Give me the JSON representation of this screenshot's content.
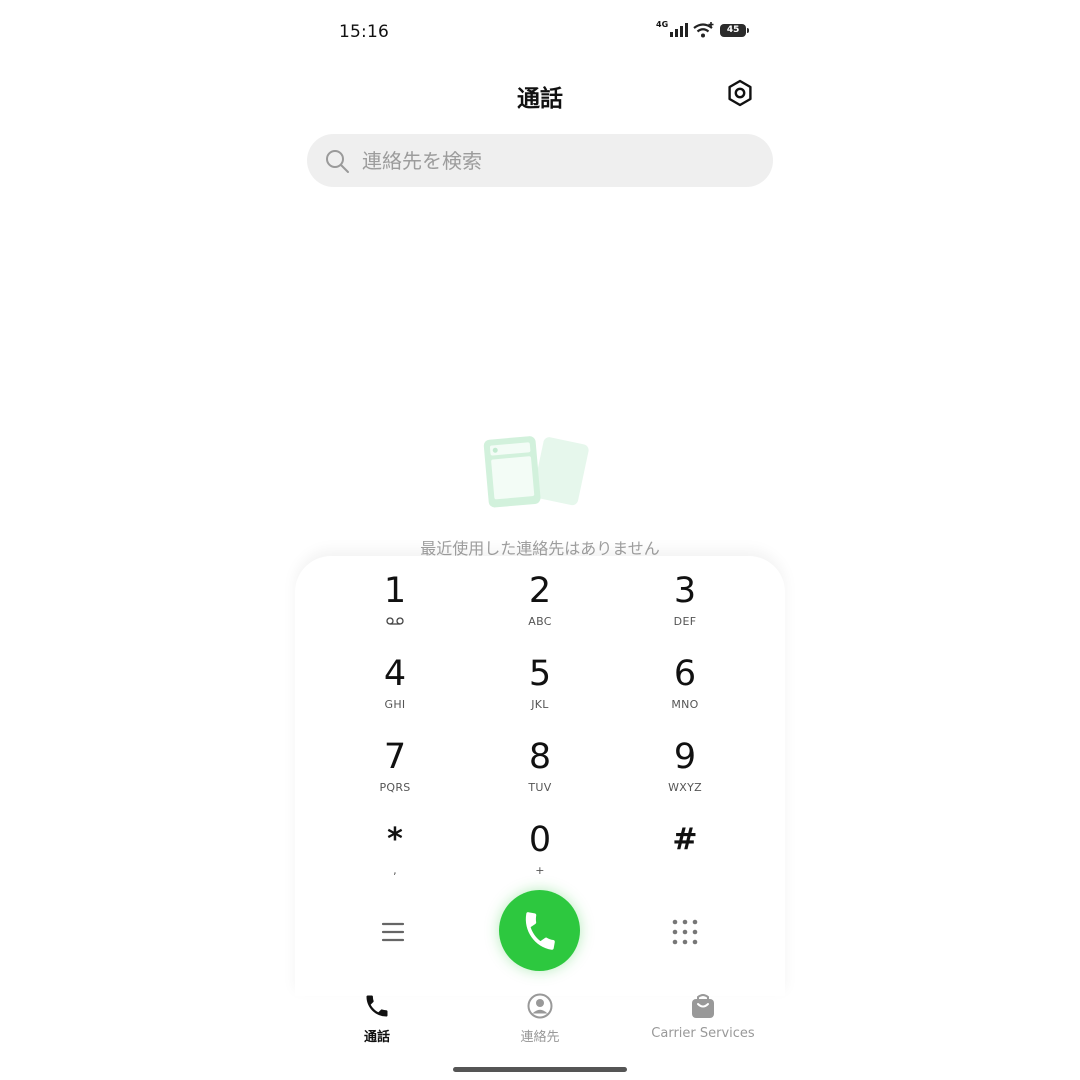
{
  "status_bar": {
    "time": "15:16",
    "network": "4G",
    "battery": "45",
    "icons": [
      "signal-icon",
      "wifi-icon",
      "battery-icon"
    ]
  },
  "header": {
    "title": "通話",
    "settings_icon": "settings-icon"
  },
  "search": {
    "placeholder": "連絡先を検索"
  },
  "empty_state": {
    "message": "最近使用した連絡先はありません"
  },
  "dialpad": {
    "keys": [
      {
        "digit": "1",
        "letters": "ꝏ"
      },
      {
        "digit": "2",
        "letters": "ABC"
      },
      {
        "digit": "3",
        "letters": "DEF"
      },
      {
        "digit": "4",
        "letters": "GHI"
      },
      {
        "digit": "5",
        "letters": "JKL"
      },
      {
        "digit": "6",
        "letters": "MNO"
      },
      {
        "digit": "7",
        "letters": "PQRS"
      },
      {
        "digit": "8",
        "letters": "TUV"
      },
      {
        "digit": "9",
        "letters": "WXYZ"
      },
      {
        "digit": "*",
        "letters": ","
      },
      {
        "digit": "0",
        "letters": "+"
      },
      {
        "digit": "#",
        "letters": ""
      }
    ],
    "call_button_color": "#2dc83f"
  },
  "bottom_nav": {
    "items": [
      {
        "label": "通話",
        "icon": "phone-icon",
        "active": true
      },
      {
        "label": "連絡先",
        "icon": "contact-icon",
        "active": false
      },
      {
        "label": "Carrier Services",
        "icon": "shopping-bag-icon",
        "active": false
      }
    ]
  }
}
